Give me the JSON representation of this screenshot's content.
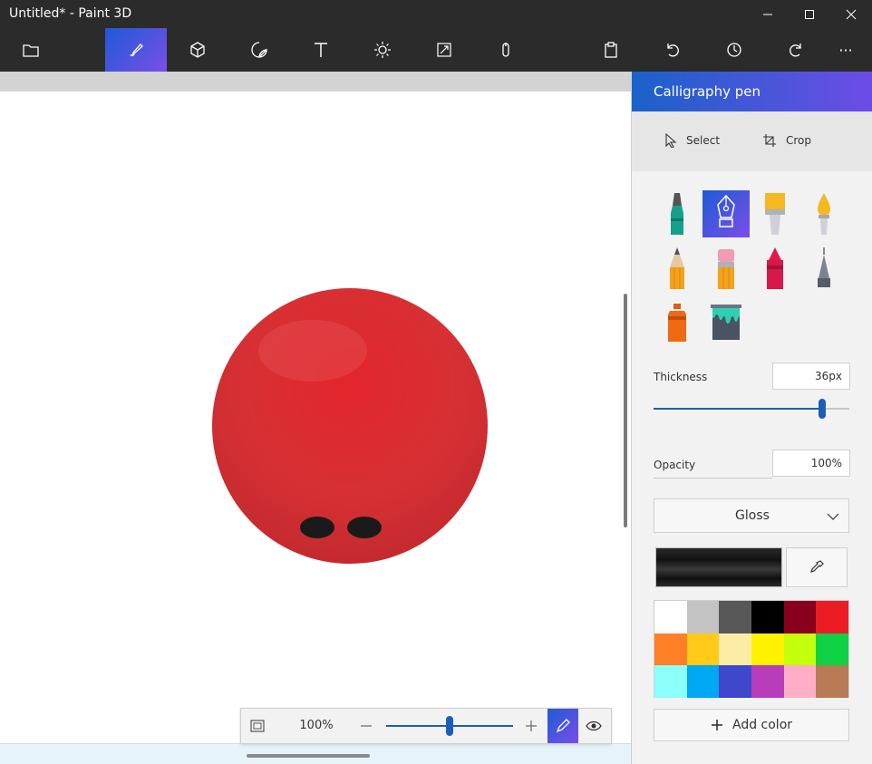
{
  "window": {
    "title": "Untitled* - Paint 3D"
  },
  "toolbar": {
    "items": [
      "menu",
      "brushes",
      "3d-shapes",
      "stickers",
      "text",
      "effects",
      "canvas",
      "remix-3d",
      "paste",
      "undo",
      "history",
      "redo",
      "more"
    ],
    "more_label": "···"
  },
  "panel": {
    "title": "Calligraphy pen",
    "select_label": "Select",
    "crop_label": "Crop",
    "thickness_label": "Thickness",
    "thickness_value": "36px",
    "thickness_level": 0.86,
    "opacity_label": "Opacity",
    "opacity_value": "100%",
    "finish_value": "Gloss",
    "add_color_label": "Add color",
    "brushes": [
      "marker",
      "calligraphy-pen",
      "oil-brush",
      "watercolor",
      "pencil",
      "eraser",
      "crayon",
      "pixel-pen",
      "spray-can",
      "fill"
    ],
    "palette": [
      "#ffffff",
      "#c3c3c3",
      "#585858",
      "#000000",
      "#88001b",
      "#ec1c24",
      "#ff7f27",
      "#ffca18",
      "#fdeca6",
      "#fff200",
      "#c4ff0e",
      "#0ed145",
      "#8cfffb",
      "#00a8f3",
      "#3f48cc",
      "#b83dba",
      "#ffaec8",
      "#b97a56"
    ]
  },
  "zoom": {
    "value": "100%",
    "level": 0.5
  },
  "colors": {
    "accent": "#1e5bd6",
    "accent2": "#7a4ee8",
    "ball": "#d9262b"
  }
}
